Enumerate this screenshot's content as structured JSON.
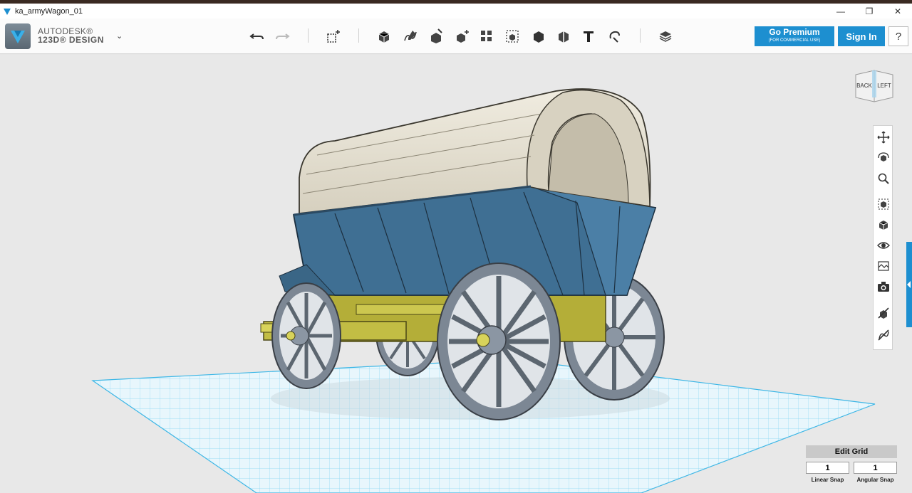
{
  "window": {
    "title": "ka_armyWagon_01",
    "minimize": "—",
    "restore": "❐",
    "close": "✕"
  },
  "brand": {
    "line1": "AUTODESK®",
    "line2": "123D® DESIGN",
    "menu_chevron": "⌄"
  },
  "toolbar": {
    "undo_icon": "undo-icon",
    "redo_icon": "redo-icon",
    "tools": [
      "transform",
      "primitives",
      "sketch",
      "construct",
      "modify",
      "pattern",
      "grouping",
      "combine",
      "measure",
      "text",
      "snap",
      "material"
    ]
  },
  "account": {
    "premium_label": "Go Premium",
    "premium_sub": "(FOR COMMERCIAL USE)",
    "signin_label": "Sign In",
    "help_label": "?"
  },
  "viewcube": {
    "back": "BACK",
    "left": "LEFT"
  },
  "grid": {
    "edit_label": "Edit Grid",
    "linear_snap_value": "1",
    "angular_snap_value": "1",
    "linear_snap_label": "Linear Snap",
    "angular_snap_label": "Angular Snap"
  },
  "colors": {
    "accent": "#1d8fd0",
    "wagon_body": "#3f6f93",
    "canvas_cover": "#e4dfd0",
    "undercarriage": "#a9a531",
    "wheels": "#8a95a3",
    "grid": "#5cc8f0"
  }
}
